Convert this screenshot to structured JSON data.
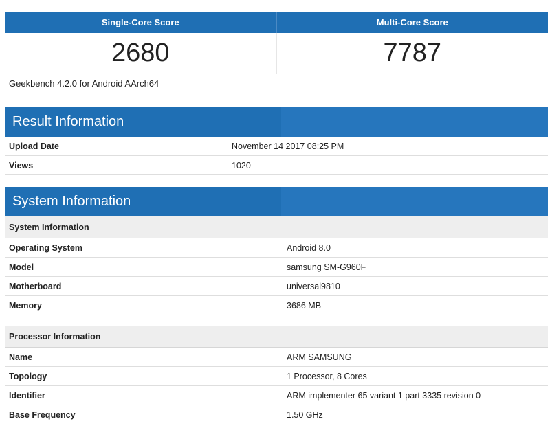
{
  "scores": {
    "single_core_label": "Single-Core Score",
    "multi_core_label": "Multi-Core Score",
    "single_core_value": "2680",
    "multi_core_value": "7787",
    "version": "Geekbench 4.2.0 for Android AArch64"
  },
  "result_information": {
    "title": "Result Information",
    "rows": [
      {
        "key": "Upload Date",
        "value": "November 14 2017 08:25 PM"
      },
      {
        "key": "Views",
        "value": "1020"
      }
    ]
  },
  "system_information": {
    "title": "System Information",
    "system_group": {
      "title": "System Information",
      "rows": [
        {
          "key": "Operating System",
          "value": "Android 8.0"
        },
        {
          "key": "Model",
          "value": "samsung SM-G960F"
        },
        {
          "key": "Motherboard",
          "value": "universal9810"
        },
        {
          "key": "Memory",
          "value": "3686 MB"
        }
      ]
    },
    "processor_group": {
      "title": "Processor Information",
      "rows": [
        {
          "key": "Name",
          "value": "ARM SAMSUNG"
        },
        {
          "key": "Topology",
          "value": "1 Processor, 8 Cores"
        },
        {
          "key": "Identifier",
          "value": "ARM implementer 65 variant 1 part 3335 revision 0"
        },
        {
          "key": "Base Frequency",
          "value": "1.50 GHz"
        }
      ]
    }
  },
  "colors": {
    "header_blue": "#1f6fb4",
    "subhead_gray": "#eeeeee"
  }
}
